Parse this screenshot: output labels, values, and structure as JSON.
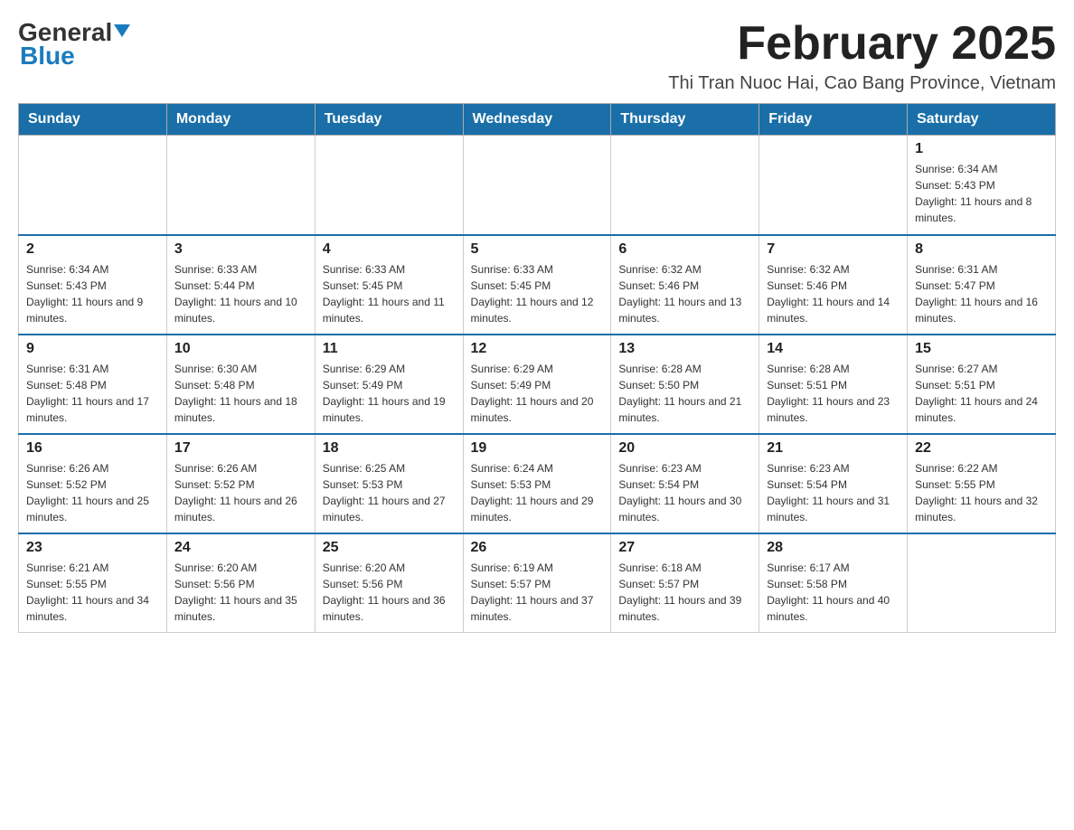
{
  "logo": {
    "general": "General",
    "blue": "Blue"
  },
  "title": "February 2025",
  "subtitle": "Thi Tran Nuoc Hai, Cao Bang Province, Vietnam",
  "days_of_week": [
    "Sunday",
    "Monday",
    "Tuesday",
    "Wednesday",
    "Thursday",
    "Friday",
    "Saturday"
  ],
  "weeks": [
    [
      {
        "day": "",
        "info": ""
      },
      {
        "day": "",
        "info": ""
      },
      {
        "day": "",
        "info": ""
      },
      {
        "day": "",
        "info": ""
      },
      {
        "day": "",
        "info": ""
      },
      {
        "day": "",
        "info": ""
      },
      {
        "day": "1",
        "info": "Sunrise: 6:34 AM\nSunset: 5:43 PM\nDaylight: 11 hours and 8 minutes."
      }
    ],
    [
      {
        "day": "2",
        "info": "Sunrise: 6:34 AM\nSunset: 5:43 PM\nDaylight: 11 hours and 9 minutes."
      },
      {
        "day": "3",
        "info": "Sunrise: 6:33 AM\nSunset: 5:44 PM\nDaylight: 11 hours and 10 minutes."
      },
      {
        "day": "4",
        "info": "Sunrise: 6:33 AM\nSunset: 5:45 PM\nDaylight: 11 hours and 11 minutes."
      },
      {
        "day": "5",
        "info": "Sunrise: 6:33 AM\nSunset: 5:45 PM\nDaylight: 11 hours and 12 minutes."
      },
      {
        "day": "6",
        "info": "Sunrise: 6:32 AM\nSunset: 5:46 PM\nDaylight: 11 hours and 13 minutes."
      },
      {
        "day": "7",
        "info": "Sunrise: 6:32 AM\nSunset: 5:46 PM\nDaylight: 11 hours and 14 minutes."
      },
      {
        "day": "8",
        "info": "Sunrise: 6:31 AM\nSunset: 5:47 PM\nDaylight: 11 hours and 16 minutes."
      }
    ],
    [
      {
        "day": "9",
        "info": "Sunrise: 6:31 AM\nSunset: 5:48 PM\nDaylight: 11 hours and 17 minutes."
      },
      {
        "day": "10",
        "info": "Sunrise: 6:30 AM\nSunset: 5:48 PM\nDaylight: 11 hours and 18 minutes."
      },
      {
        "day": "11",
        "info": "Sunrise: 6:29 AM\nSunset: 5:49 PM\nDaylight: 11 hours and 19 minutes."
      },
      {
        "day": "12",
        "info": "Sunrise: 6:29 AM\nSunset: 5:49 PM\nDaylight: 11 hours and 20 minutes."
      },
      {
        "day": "13",
        "info": "Sunrise: 6:28 AM\nSunset: 5:50 PM\nDaylight: 11 hours and 21 minutes."
      },
      {
        "day": "14",
        "info": "Sunrise: 6:28 AM\nSunset: 5:51 PM\nDaylight: 11 hours and 23 minutes."
      },
      {
        "day": "15",
        "info": "Sunrise: 6:27 AM\nSunset: 5:51 PM\nDaylight: 11 hours and 24 minutes."
      }
    ],
    [
      {
        "day": "16",
        "info": "Sunrise: 6:26 AM\nSunset: 5:52 PM\nDaylight: 11 hours and 25 minutes."
      },
      {
        "day": "17",
        "info": "Sunrise: 6:26 AM\nSunset: 5:52 PM\nDaylight: 11 hours and 26 minutes."
      },
      {
        "day": "18",
        "info": "Sunrise: 6:25 AM\nSunset: 5:53 PM\nDaylight: 11 hours and 27 minutes."
      },
      {
        "day": "19",
        "info": "Sunrise: 6:24 AM\nSunset: 5:53 PM\nDaylight: 11 hours and 29 minutes."
      },
      {
        "day": "20",
        "info": "Sunrise: 6:23 AM\nSunset: 5:54 PM\nDaylight: 11 hours and 30 minutes."
      },
      {
        "day": "21",
        "info": "Sunrise: 6:23 AM\nSunset: 5:54 PM\nDaylight: 11 hours and 31 minutes."
      },
      {
        "day": "22",
        "info": "Sunrise: 6:22 AM\nSunset: 5:55 PM\nDaylight: 11 hours and 32 minutes."
      }
    ],
    [
      {
        "day": "23",
        "info": "Sunrise: 6:21 AM\nSunset: 5:55 PM\nDaylight: 11 hours and 34 minutes."
      },
      {
        "day": "24",
        "info": "Sunrise: 6:20 AM\nSunset: 5:56 PM\nDaylight: 11 hours and 35 minutes."
      },
      {
        "day": "25",
        "info": "Sunrise: 6:20 AM\nSunset: 5:56 PM\nDaylight: 11 hours and 36 minutes."
      },
      {
        "day": "26",
        "info": "Sunrise: 6:19 AM\nSunset: 5:57 PM\nDaylight: 11 hours and 37 minutes."
      },
      {
        "day": "27",
        "info": "Sunrise: 6:18 AM\nSunset: 5:57 PM\nDaylight: 11 hours and 39 minutes."
      },
      {
        "day": "28",
        "info": "Sunrise: 6:17 AM\nSunset: 5:58 PM\nDaylight: 11 hours and 40 minutes."
      },
      {
        "day": "",
        "info": ""
      }
    ]
  ]
}
